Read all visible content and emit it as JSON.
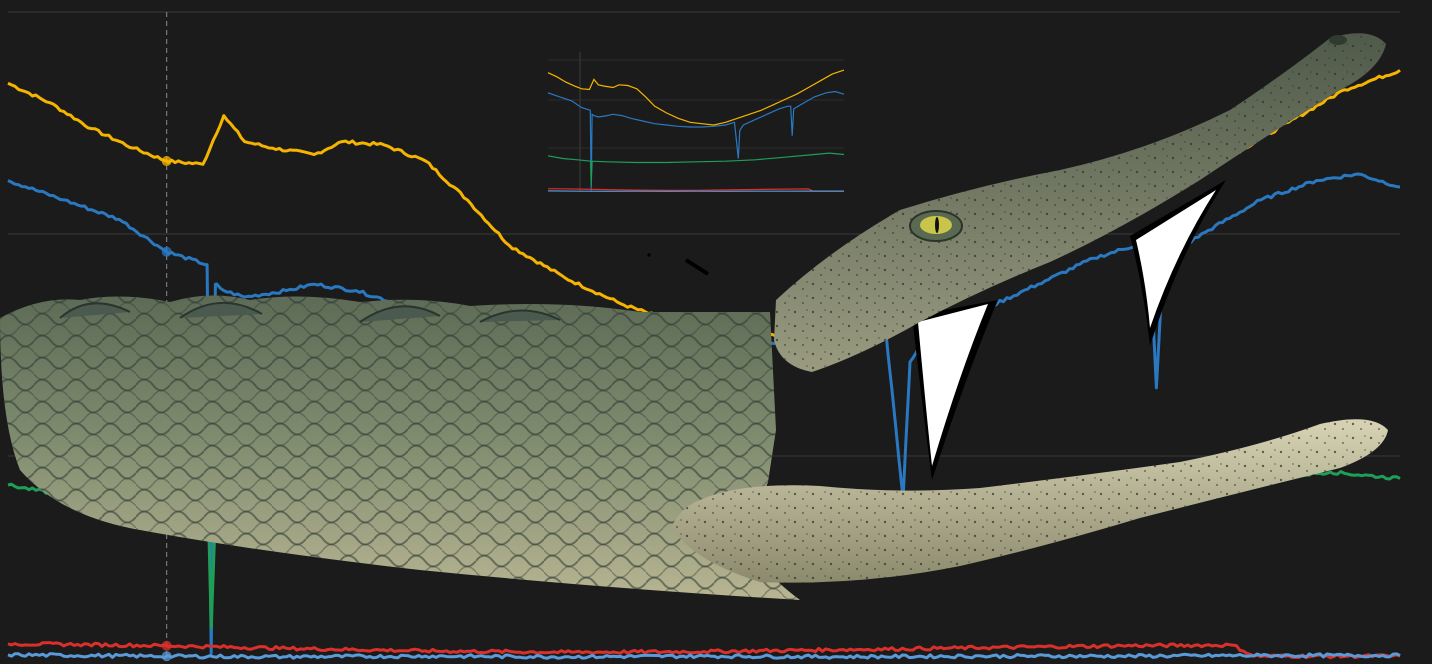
{
  "chart_data": {
    "type": "line",
    "title": "",
    "xlabel": "",
    "ylabel": "",
    "grid": true,
    "legend": "none",
    "x_range": [
      0,
      100
    ],
    "y_range": [
      0,
      100
    ],
    "cursor_x": 11.4,
    "series": [
      {
        "color": "#f5b400",
        "x": [
          0,
          3,
          6,
          9,
          11.4,
          14,
          15.5,
          17,
          19,
          22,
          24,
          27,
          30,
          33,
          36,
          40,
          44,
          48,
          52,
          56,
          60,
          64,
          68,
          72,
          76,
          80,
          84,
          88,
          92,
          96,
          100
        ],
        "values": [
          89,
          86,
          82,
          79,
          77,
          76.5,
          84,
          80,
          79,
          78,
          80,
          79.5,
          77,
          71,
          64,
          59,
          55,
          52,
          51,
          50,
          52,
          55,
          58,
          61,
          65,
          69,
          73,
          78,
          83,
          88,
          91
        ]
      },
      {
        "color": "#2a78c0",
        "x": [
          0,
          4,
          8,
          11.4,
          14.3,
          14.6,
          14.9,
          15.5,
          17,
          20,
          22,
          25,
          28,
          32,
          36,
          40,
          44,
          48,
          52,
          56,
          60,
          63,
          64.3,
          64.8,
          66,
          70,
          74,
          78,
          81,
          82,
          82.5,
          83,
          86,
          90,
          94,
          97,
          100
        ],
        "values": [
          74,
          71,
          68,
          63,
          61,
          1,
          58,
          57,
          56,
          57,
          58,
          57,
          55,
          53,
          51,
          50,
          49,
          48.5,
          48.5,
          49,
          50,
          52,
          25,
          46,
          50,
          54,
          58,
          62,
          64,
          64,
          42,
          62,
          66,
          71,
          74,
          75,
          73
        ]
      },
      {
        "color": "#1f9e57",
        "x": [
          0,
          5,
          10,
          14.4,
          14.6,
          14.9,
          20,
          30,
          40,
          50,
          60,
          70,
          80,
          90,
          95,
          100
        ],
        "values": [
          27,
          25,
          24,
          23,
          5,
          23,
          22.5,
          22,
          22,
          22.5,
          23,
          24,
          26,
          28,
          29,
          28
        ]
      },
      {
        "color": "#d9302b",
        "x": [
          0,
          5,
          11.4,
          20,
          30,
          40,
          50,
          60,
          70,
          80,
          88,
          89.5,
          100
        ],
        "values": [
          2.5,
          2.4,
          2.2,
          1.8,
          1.4,
          1.2,
          1.3,
          1.6,
          1.9,
          2.2,
          2.3,
          0.6,
          0.6
        ]
      },
      {
        "color": "#5a9ad8",
        "x": [
          0,
          10,
          20,
          30,
          40,
          50,
          60,
          70,
          80,
          90,
          100
        ],
        "values": [
          0.8,
          0.6,
          0.5,
          0.6,
          0.5,
          0.6,
          0.5,
          0.6,
          0.6,
          0.7,
          0.7
        ]
      }
    ]
  },
  "colors": {
    "background": "#1b1b1b",
    "grid": "#3a3a3a",
    "cursor": "#7f8c99"
  },
  "overlay": {
    "object": "crocodile-head",
    "skin_color": "#6f7a62",
    "belly_color": "#c9c4a4",
    "tooth_color": "#ffffff"
  }
}
